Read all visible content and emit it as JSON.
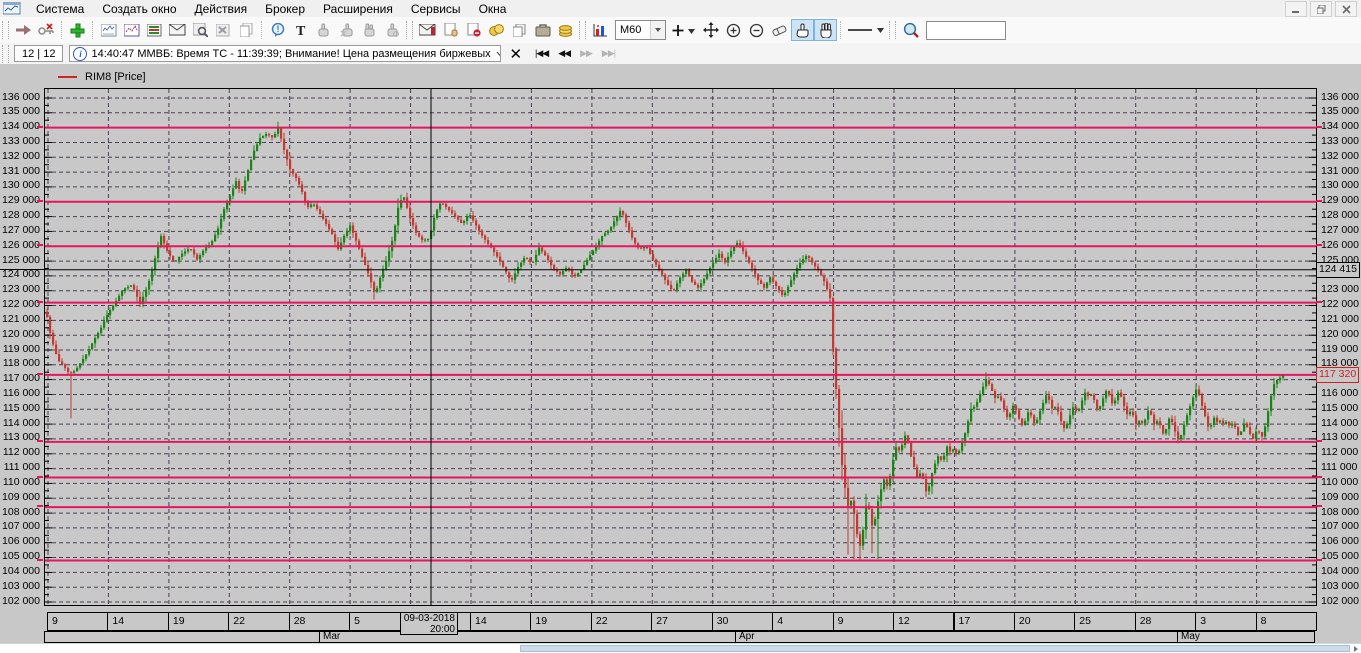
{
  "menu": {
    "items": [
      "Система",
      "Создать окно",
      "Действия",
      "Брокер",
      "Расширения",
      "Сервисы",
      "Окна"
    ]
  },
  "window_controls": {
    "minimize": "–",
    "restore": "❐",
    "close": "×"
  },
  "toolbar": {
    "timeframe": "M60",
    "search_value": "",
    "search_placeholder": "",
    "icons": [
      "connect-icon",
      "disconnect-icon",
      "add-window-icon",
      "chart-window-icon",
      "chart-window2-icon",
      "quotes-table-icon",
      "mail-chart-icon",
      "edit-chart-icon",
      "delete-chart-icon",
      "copy-chart-icon",
      "comment-bubble-icon",
      "text-tool-icon",
      "pointer-gray-icon",
      "pointer-x-gray-icon",
      "pointer2-gray-icon",
      "pointer3-gray-icon",
      "mail-red-icon",
      "order-hand-icon",
      "stop-order-icon",
      "coins-icon",
      "docs-icon",
      "briefcase-icon",
      "cash-icon",
      "chart-colored-icon",
      "add-plus-icon",
      "move-tool-icon",
      "zoom-in-icon",
      "zoom-out-icon",
      "eraser-icon",
      "pointer-tool-icon",
      "hand-tool-icon",
      "line-style-icon",
      "find-icon"
    ]
  },
  "statusbar": {
    "counter": "12 | 12",
    "message": "14:40:47  ММВБ: Время ТС - 11:39:39; Внимание! Цена размещения биржевых",
    "nav": [
      "|◀◀",
      "◀◀",
      "▶▶",
      "▶▶|"
    ]
  },
  "legend": {
    "series": "RIM8 [Price]"
  },
  "chart_data": {
    "type": "candlestick",
    "title": "RIM8 [Price]",
    "timeframe": "M60",
    "y_axis": {
      "min": 102000,
      "max": 136000,
      "step": 1000,
      "format": "space-thousands",
      "grid": true
    },
    "x_axis": {
      "day_ticks": [
        "9",
        "14",
        "19",
        "22",
        "28",
        "5",
        "9",
        "14",
        "19",
        "22",
        "27",
        "30",
        "4",
        "9",
        "12",
        "17",
        "20",
        "25",
        "28",
        "3",
        "8"
      ],
      "months": [
        {
          "label": "Mar",
          "x": 318
        },
        {
          "label": "Apr",
          "x": 734
        },
        {
          "label": "May",
          "x": 1176
        }
      ],
      "cursor_cell_index": 6
    },
    "levels": [
      134000,
      129000,
      126000,
      122200,
      112800,
      110400,
      108400,
      104800
    ],
    "last_price": 117320,
    "cursor": {
      "date": "09-03-2018",
      "time": "20:00",
      "price": 124415,
      "x": 386
    },
    "colors": {
      "up": "#1a8516",
      "down": "#c23a32",
      "level": "#e8155e",
      "grid": "#4b3d52",
      "bg": "#c8c8c8",
      "crosshair": "#000000",
      "last_price_label": "#cc2222"
    },
    "price_path": [
      [
        1,
        121600
      ],
      [
        6,
        119800
      ],
      [
        13,
        118300
      ],
      [
        19,
        117900
      ],
      [
        24,
        117400
      ],
      [
        27,
        117500
      ],
      [
        30,
        117600
      ],
      [
        36,
        118200
      ],
      [
        42,
        118800
      ],
      [
        49,
        119700
      ],
      [
        56,
        120500
      ],
      [
        63,
        121500
      ],
      [
        70,
        122200
      ],
      [
        78,
        123100
      ],
      [
        87,
        123400
      ],
      [
        95,
        122100
      ],
      [
        103,
        123400
      ],
      [
        110,
        125200
      ],
      [
        116,
        126700
      ],
      [
        122,
        125700
      ],
      [
        129,
        124900
      ],
      [
        137,
        125500
      ],
      [
        145,
        125900
      ],
      [
        152,
        125100
      ],
      [
        159,
        125800
      ],
      [
        166,
        126200
      ],
      [
        173,
        127200
      ],
      [
        179,
        128500
      ],
      [
        185,
        129400
      ],
      [
        191,
        130400
      ],
      [
        196,
        129500
      ],
      [
        202,
        130900
      ],
      [
        208,
        132300
      ],
      [
        215,
        133300
      ],
      [
        222,
        133600
      ],
      [
        228,
        133300
      ],
      [
        233,
        134000
      ],
      [
        239,
        132500
      ],
      [
        245,
        131200
      ],
      [
        252,
        130500
      ],
      [
        258,
        129500
      ],
      [
        262,
        128600
      ],
      [
        268,
        128900
      ],
      [
        274,
        128300
      ],
      [
        281,
        127500
      ],
      [
        287,
        126800
      ],
      [
        293,
        125800
      ],
      [
        299,
        126700
      ],
      [
        305,
        127400
      ],
      [
        312,
        126200
      ],
      [
        318,
        125100
      ],
      [
        324,
        124000
      ],
      [
        330,
        122700
      ],
      [
        336,
        124100
      ],
      [
        342,
        125200
      ],
      [
        348,
        126600
      ],
      [
        354,
        129000
      ],
      [
        359,
        129300
      ],
      [
        365,
        127900
      ],
      [
        371,
        126900
      ],
      [
        377,
        126400
      ],
      [
        384,
        126500
      ],
      [
        390,
        128200
      ],
      [
        396,
        129000
      ],
      [
        403,
        128500
      ],
      [
        410,
        128000
      ],
      [
        417,
        127500
      ],
      [
        424,
        128200
      ],
      [
        431,
        127400
      ],
      [
        438,
        126600
      ],
      [
        445,
        126000
      ],
      [
        452,
        125300
      ],
      [
        459,
        124500
      ],
      [
        466,
        123600
      ],
      [
        473,
        124600
      ],
      [
        480,
        125300
      ],
      [
        487,
        124800
      ],
      [
        494,
        125900
      ],
      [
        501,
        125300
      ],
      [
        508,
        124500
      ],
      [
        515,
        124100
      ],
      [
        522,
        124600
      ],
      [
        529,
        123900
      ],
      [
        536,
        124400
      ],
      [
        543,
        125200
      ],
      [
        550,
        125900
      ],
      [
        557,
        126700
      ],
      [
        564,
        127100
      ],
      [
        570,
        127800
      ],
      [
        576,
        128500
      ],
      [
        582,
        127400
      ],
      [
        588,
        126400
      ],
      [
        594,
        125800
      ],
      [
        601,
        126000
      ],
      [
        608,
        125100
      ],
      [
        615,
        124300
      ],
      [
        622,
        123500
      ],
      [
        628,
        122900
      ],
      [
        634,
        123800
      ],
      [
        641,
        124400
      ],
      [
        647,
        123600
      ],
      [
        653,
        123200
      ],
      [
        660,
        123900
      ],
      [
        667,
        124800
      ],
      [
        674,
        125500
      ],
      [
        680,
        124900
      ],
      [
        687,
        125800
      ],
      [
        693,
        126300
      ],
      [
        700,
        125400
      ],
      [
        707,
        124500
      ],
      [
        713,
        123700
      ],
      [
        719,
        123200
      ],
      [
        725,
        123900
      ],
      [
        732,
        123200
      ],
      [
        738,
        122600
      ],
      [
        744,
        123400
      ],
      [
        750,
        124300
      ],
      [
        756,
        125000
      ],
      [
        762,
        125400
      ],
      [
        768,
        124800
      ],
      [
        774,
        124300
      ],
      [
        780,
        123500
      ],
      [
        786,
        122300
      ],
      [
        789,
        117500
      ],
      [
        792,
        115800
      ],
      [
        795,
        112700
      ],
      [
        798,
        110500
      ],
      [
        801,
        109300
      ],
      [
        804,
        108100
      ],
      [
        807,
        109200
      ],
      [
        810,
        107300
      ],
      [
        813,
        106200
      ],
      [
        816,
        105600
      ],
      [
        819,
        107500
      ],
      [
        822,
        109000
      ],
      [
        825,
        107900
      ],
      [
        828,
        106800
      ],
      [
        831,
        108000
      ],
      [
        834,
        109200
      ],
      [
        837,
        109800
      ],
      [
        840,
        110500
      ],
      [
        843,
        109500
      ],
      [
        846,
        111000
      ],
      [
        849,
        111900
      ],
      [
        852,
        112700
      ],
      [
        855,
        112000
      ],
      [
        858,
        112900
      ],
      [
        861,
        113400
      ],
      [
        864,
        112400
      ],
      [
        867,
        111500
      ],
      [
        870,
        110900
      ],
      [
        873,
        110200
      ],
      [
        876,
        110900
      ],
      [
        879,
        110000
      ],
      [
        882,
        109200
      ],
      [
        885,
        110100
      ],
      [
        888,
        111000
      ],
      [
        891,
        111500
      ],
      [
        894,
        112000
      ],
      [
        897,
        111400
      ],
      [
        900,
        112100
      ],
      [
        903,
        112700
      ],
      [
        906,
        111900
      ],
      [
        909,
        112500
      ],
      [
        912,
        111800
      ],
      [
        915,
        112400
      ],
      [
        918,
        113000
      ],
      [
        921,
        113600
      ],
      [
        924,
        114500
      ],
      [
        927,
        115300
      ],
      [
        930,
        115100
      ],
      [
        933,
        115700
      ],
      [
        936,
        116200
      ],
      [
        939,
        116700
      ],
      [
        942,
        117100
      ],
      [
        945,
        116500
      ],
      [
        948,
        116100
      ],
      [
        951,
        115600
      ],
      [
        954,
        116000
      ],
      [
        957,
        115400
      ],
      [
        960,
        114800
      ],
      [
        963,
        114300
      ],
      [
        966,
        114900
      ],
      [
        969,
        115400
      ],
      [
        972,
        114700
      ],
      [
        975,
        114200
      ],
      [
        978,
        113800
      ],
      [
        981,
        114400
      ],
      [
        984,
        115000
      ],
      [
        987,
        114400
      ],
      [
        990,
        113900
      ],
      [
        993,
        114500
      ],
      [
        996,
        115100
      ],
      [
        999,
        115600
      ],
      [
        1002,
        116100
      ],
      [
        1005,
        115400
      ],
      [
        1008,
        114900
      ],
      [
        1011,
        115300
      ],
      [
        1014,
        114600
      ],
      [
        1017,
        114000
      ],
      [
        1020,
        113600
      ],
      [
        1023,
        114200
      ],
      [
        1026,
        114800
      ],
      [
        1029,
        115300
      ],
      [
        1032,
        114700
      ],
      [
        1035,
        115200
      ],
      [
        1038,
        115800
      ],
      [
        1041,
        116300
      ],
      [
        1044,
        115700
      ],
      [
        1047,
        116100
      ],
      [
        1050,
        115400
      ],
      [
        1053,
        114800
      ],
      [
        1056,
        115400
      ],
      [
        1059,
        115900
      ],
      [
        1062,
        116400
      ],
      [
        1065,
        115800
      ],
      [
        1068,
        115200
      ],
      [
        1071,
        115800
      ],
      [
        1074,
        116300
      ],
      [
        1077,
        115600
      ],
      [
        1080,
        115000
      ],
      [
        1083,
        114500
      ],
      [
        1086,
        115000
      ],
      [
        1089,
        114400
      ],
      [
        1092,
        113800
      ],
      [
        1095,
        114400
      ],
      [
        1098,
        113900
      ],
      [
        1101,
        114500
      ],
      [
        1104,
        115100
      ],
      [
        1107,
        114400
      ],
      [
        1110,
        113800
      ],
      [
        1113,
        114400
      ],
      [
        1116,
        113700
      ],
      [
        1119,
        113200
      ],
      [
        1122,
        113900
      ],
      [
        1125,
        114600
      ],
      [
        1128,
        113900
      ],
      [
        1131,
        113300
      ],
      [
        1134,
        112800
      ],
      [
        1137,
        113500
      ],
      [
        1140,
        114200
      ],
      [
        1143,
        114800
      ],
      [
        1146,
        115400
      ],
      [
        1149,
        116000
      ],
      [
        1152,
        116500
      ],
      [
        1155,
        115700
      ],
      [
        1158,
        115000
      ],
      [
        1161,
        114300
      ],
      [
        1164,
        113600
      ],
      [
        1167,
        114100
      ],
      [
        1170,
        114600
      ],
      [
        1173,
        113900
      ],
      [
        1176,
        114400
      ],
      [
        1179,
        113800
      ],
      [
        1182,
        114300
      ],
      [
        1185,
        113700
      ],
      [
        1188,
        114200
      ],
      [
        1191,
        113600
      ],
      [
        1194,
        113100
      ],
      [
        1197,
        113700
      ],
      [
        1200,
        114200
      ],
      [
        1203,
        113600
      ],
      [
        1206,
        113200
      ],
      [
        1209,
        112900
      ],
      [
        1212,
        113800
      ],
      [
        1215,
        113300
      ],
      [
        1218,
        113100
      ],
      [
        1221,
        114200
      ],
      [
        1224,
        115200
      ],
      [
        1227,
        116300
      ],
      [
        1230,
        116900
      ],
      [
        1233,
        117000
      ],
      [
        1236,
        117200
      ],
      [
        1239,
        117400
      ]
    ],
    "spikes": [
      {
        "x": 27,
        "low": 114400
      },
      {
        "x": 232,
        "high": 134400
      },
      {
        "x": 330,
        "low": 122400
      },
      {
        "x": 804,
        "low": 105200
      },
      {
        "x": 810,
        "low": 104900
      },
      {
        "x": 816,
        "low": 104800
      },
      {
        "x": 828,
        "low": 105300
      },
      {
        "x": 834,
        "low": 104900
      },
      {
        "x": 942,
        "high": 117500
      }
    ]
  }
}
